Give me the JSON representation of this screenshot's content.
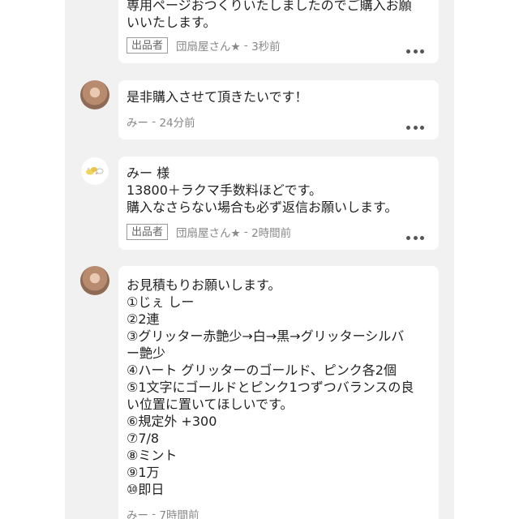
{
  "comments": [
    {
      "text": "専用ページおつくりいたしましたのでご購入お願\nいいたします。",
      "seller_badge": "出品者",
      "author": "団扇屋さん★",
      "time": "3秒前",
      "separator": " - "
    },
    {
      "text": "是非購入させて頂きたいです！",
      "author": "みー",
      "time": "24分前",
      "separator": " - "
    },
    {
      "text": "みー 様\n13800＋ラクマ手数料ほどです。\n購入なさらない場合も必ず返信お願いします。",
      "seller_badge": "出品者",
      "author": "団扇屋さん★",
      "time": "2時間前",
      "separator": " - "
    },
    {
      "text": "お見積もりお願いします。\n①じぇ しー\n②2連\n③グリッター赤艶少→白→黒→グリッターシルバ\nー艶少\n④ハート グリッターのゴールド、ピンク各2個\n⑤1文字にゴールドとピンク1つずつバランスの良\nい位置に置いてほしいです。\n⑥規定外 +300\n⑦7/8\n⑧ミント\n⑨1万\n⑩即日",
      "author": "みー",
      "time": "7時間前",
      "separator": " - "
    }
  ],
  "icons": {
    "more": "more-horizontal-icon",
    "buyer_avatar": "user-avatar",
    "seller_avatar": "shop-avatar"
  },
  "colors": {
    "feed_background": "#f1f1f1",
    "card_background": "#ffffff",
    "meta_text": "#888888"
  }
}
